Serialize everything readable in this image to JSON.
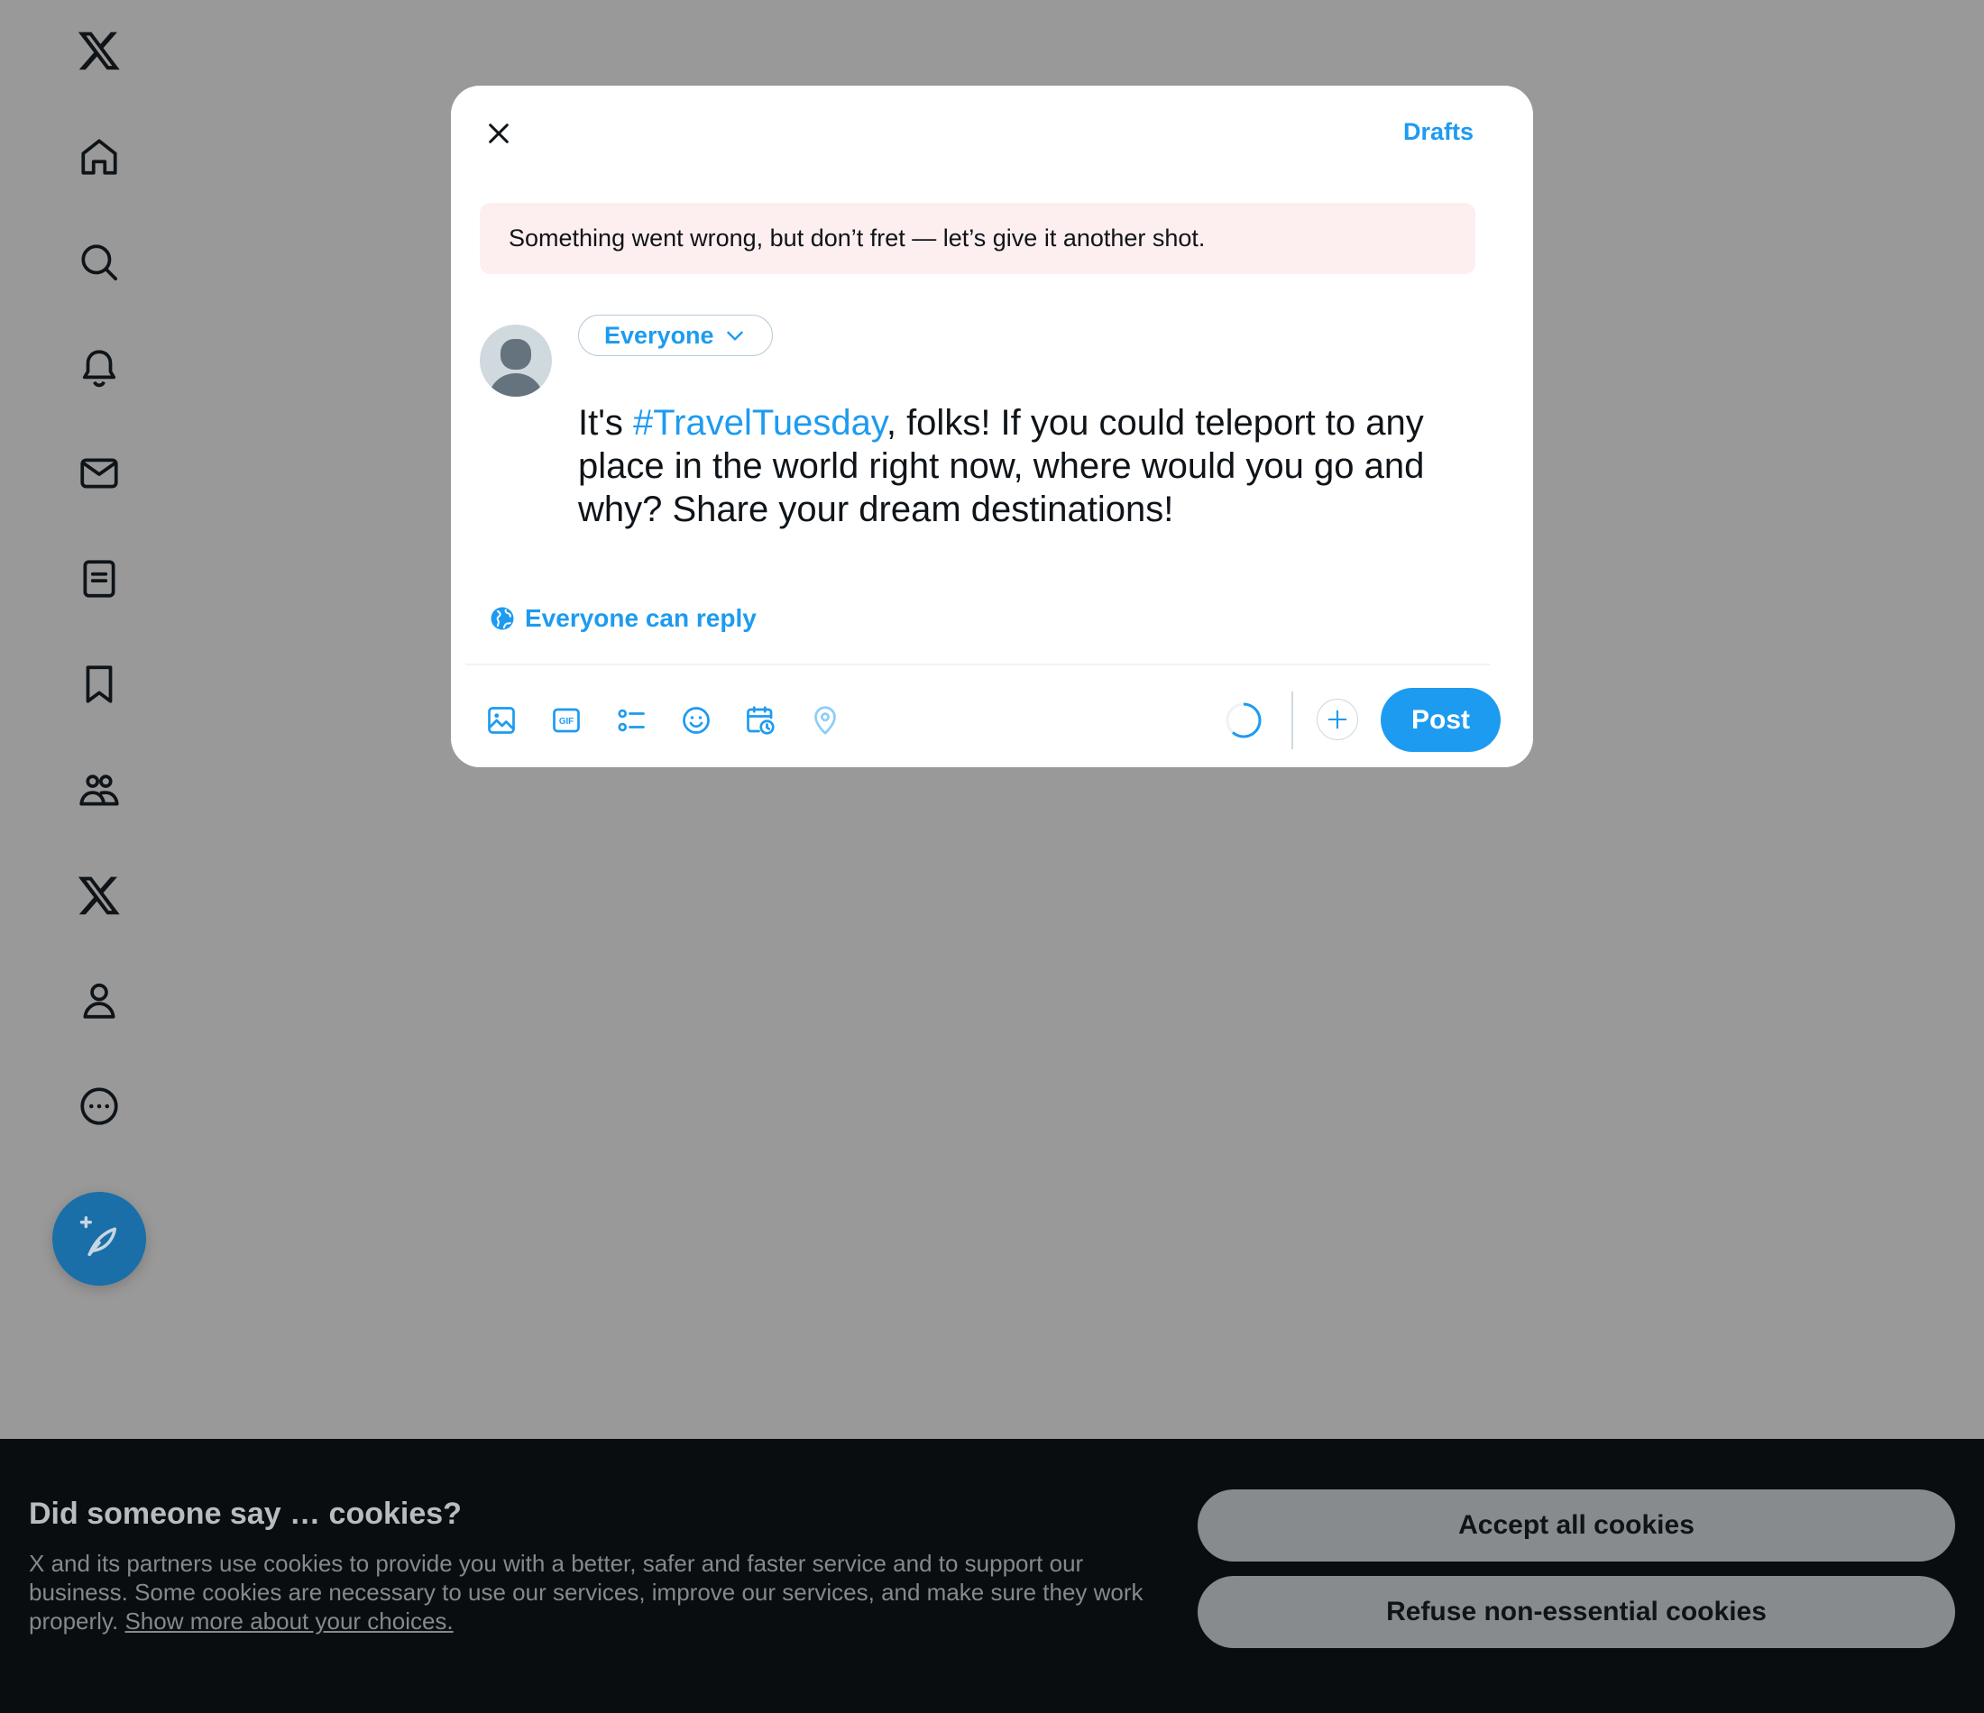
{
  "sidebar": {
    "items": [
      {
        "icon": "x-logo-icon"
      },
      {
        "icon": "home-icon"
      },
      {
        "icon": "search-icon"
      },
      {
        "icon": "notifications-bell-icon"
      },
      {
        "icon": "messages-envelope-icon"
      },
      {
        "icon": "lists-document-icon"
      },
      {
        "icon": "bookmark-icon"
      },
      {
        "icon": "communities-people-icon"
      },
      {
        "icon": "premium-x-icon"
      },
      {
        "icon": "profile-person-icon"
      },
      {
        "icon": "more-circle-icon"
      }
    ],
    "compose_icon": "compose-feather-icon"
  },
  "modal": {
    "close_icon": "close-icon",
    "drafts_label": "Drafts",
    "error_message": "Something went wrong, but don’t fret — let’s give it another shot.",
    "audience_label": "Everyone",
    "tweet": {
      "before": "It's ",
      "hashtag": "#TravelTuesday",
      "after": ", folks! If you could teleport to any place in the world right now, where would you go and why? Share your dream destinations!"
    },
    "reply_setting_label": "Everyone can reply",
    "toolbar_icons": [
      "image-icon",
      "gif-icon",
      "poll-icon",
      "emoji-icon",
      "schedule-icon",
      "location-icon"
    ],
    "gif_text": "GIF",
    "post_label": "Post"
  },
  "cookie_banner": {
    "title": "Did someone say … cookies?",
    "body": "X and its partners use cookies to provide you with a better, safer and faster service and to support our business. Some cookies are necessary to use our services, improve our services, and make sure they work properly.",
    "link_label": "Show more about your choices.",
    "accept_label": "Accept all cookies",
    "refuse_label": "Refuse non-essential cookies"
  },
  "colors": {
    "accent": "#1d9bf0",
    "overlay": "#999999",
    "error_bg": "#fdeeef",
    "cookie_bg": "#090d10"
  }
}
